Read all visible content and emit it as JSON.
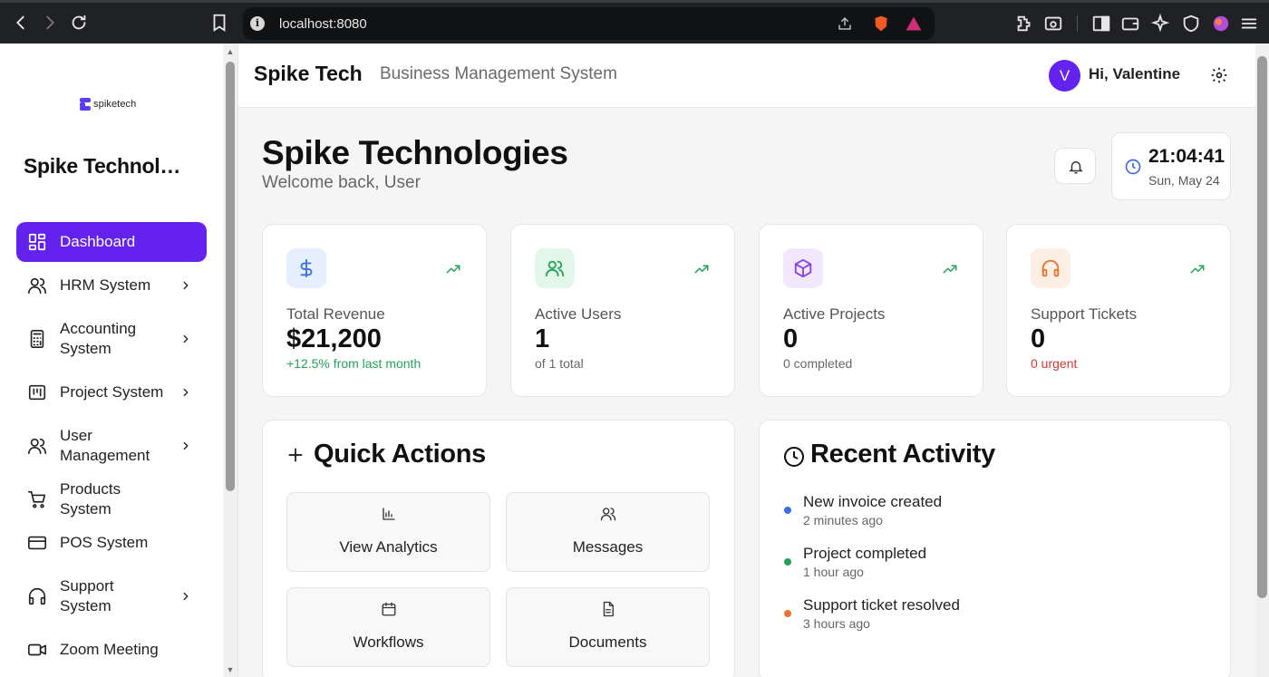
{
  "browser": {
    "url": "localhost:8080"
  },
  "sidebar": {
    "logo_text": "spiketech",
    "org_name": "Spike Technologies",
    "items": [
      {
        "label": "Dashboard",
        "icon": "dashboard-icon",
        "active": true,
        "chevron": false
      },
      {
        "label": "HRM System",
        "icon": "users-icon",
        "chevron": true
      },
      {
        "label": "Accounting System",
        "icon": "calculator-icon",
        "chevron": true
      },
      {
        "label": "Project System",
        "icon": "project-icon",
        "chevron": true
      },
      {
        "label": "User Management",
        "icon": "users-icon",
        "chevron": true
      },
      {
        "label": "Products System",
        "icon": "cart-icon",
        "chevron": false
      },
      {
        "label": "POS System",
        "icon": "credit-card-icon",
        "chevron": false
      },
      {
        "label": "Support System",
        "icon": "headphones-icon",
        "chevron": true
      },
      {
        "label": "Zoom Meeting",
        "icon": "video-icon",
        "chevron": false
      }
    ]
  },
  "topbar": {
    "brand": "Spike Tech",
    "subtitle": "Business Management System",
    "avatar_letter": "V",
    "greeting": "Hi, Valentine"
  },
  "main": {
    "title": "Spike Technologies",
    "welcome": "Welcome back, User",
    "clock": {
      "time": "21:04:41",
      "date": "Sun, May 24"
    },
    "stats": [
      {
        "label": "Total Revenue",
        "value": "$21,200",
        "note": "+12.5% from last month",
        "note_color": "#22a35a",
        "icon": "dollar-icon",
        "icon_bg": "#e6efff",
        "icon_color": "#3a6de0"
      },
      {
        "label": "Active Users",
        "value": "1",
        "note": "of 1 total",
        "note_color": "#666666",
        "icon": "users-icon",
        "icon_bg": "#e3f6ea",
        "icon_color": "#22a35a"
      },
      {
        "label": "Active Projects",
        "value": "0",
        "note": "0 completed",
        "note_color": "#666666",
        "icon": "box-icon",
        "icon_bg": "#f1e8fd",
        "icon_color": "#8a3fe0"
      },
      {
        "label": "Support Tickets",
        "value": "0",
        "note": "0 urgent",
        "note_color": "#d93535",
        "icon": "headphones-icon",
        "icon_bg": "#fdeee3",
        "icon_color": "#e87430"
      }
    ],
    "quick_actions": {
      "title": "Quick Actions",
      "items": [
        {
          "label": "View Analytics",
          "icon": "bar-chart-icon"
        },
        {
          "label": "Messages",
          "icon": "users-icon"
        },
        {
          "label": "Workflows",
          "icon": "calendar-icon"
        },
        {
          "label": "Documents",
          "icon": "document-icon"
        }
      ]
    },
    "recent_activity": {
      "title": "Recent Activity",
      "items": [
        {
          "text": "New invoice created",
          "when": "2 minutes ago",
          "dot": "#3a6de0"
        },
        {
          "text": "Project completed",
          "when": "1 hour ago",
          "dot": "#22a35a"
        },
        {
          "text": "Support ticket resolved",
          "when": "3 hours ago",
          "dot": "#e87430"
        }
      ]
    }
  }
}
